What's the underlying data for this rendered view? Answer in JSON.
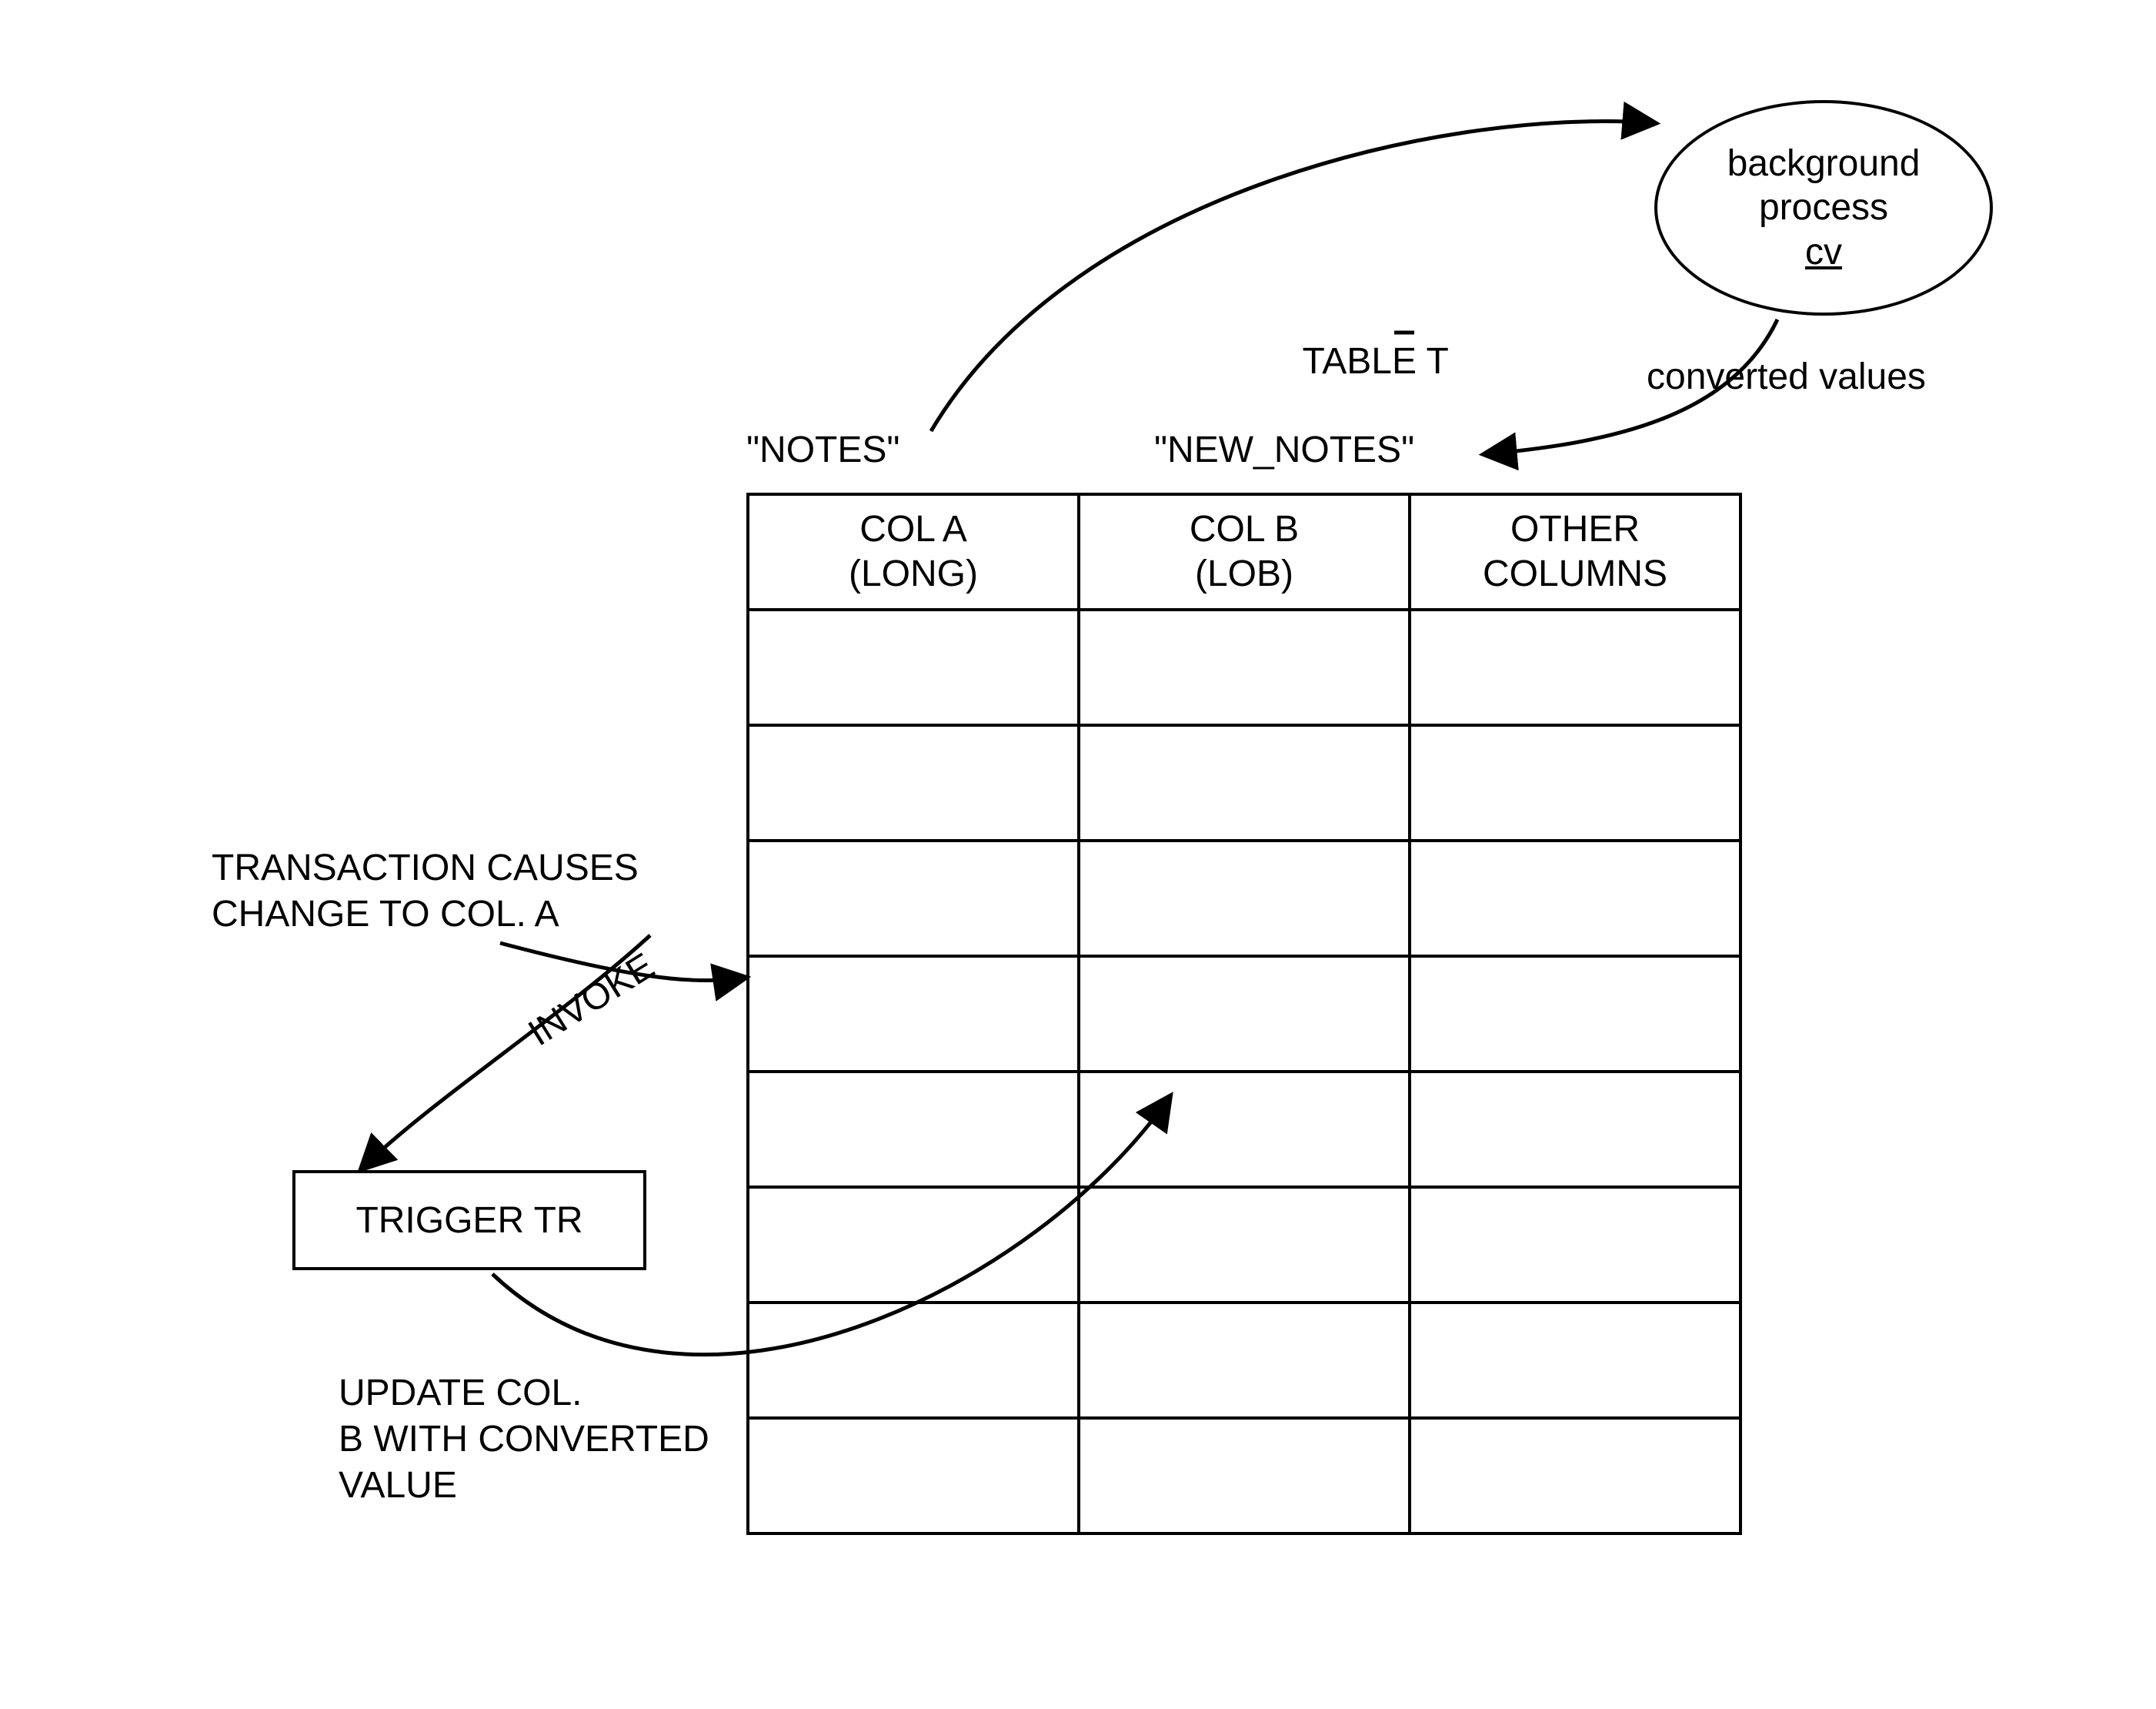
{
  "table_title": "TABLE T",
  "notes_label": "\"NOTES\"",
  "new_notes_label": "\"NEW_NOTES\"",
  "columns": {
    "a": {
      "name": "COL A",
      "type": "(LONG)"
    },
    "b": {
      "name": "COL B",
      "type": "(LOB)"
    },
    "c": {
      "name": "OTHER",
      "type": "COLUMNS"
    }
  },
  "bg_process": {
    "line1": "background",
    "line2": "process",
    "cv": "cv"
  },
  "converted_values_label": "converted values",
  "transaction_text": "TRANSACTION CAUSES\nCHANGE TO COL. A",
  "invoke_label": "INVOKE",
  "trigger_label": "TRIGGER TR",
  "update_text": "UPDATE COL.\nB WITH CONVERTED\nVALUE",
  "underline_char": "T"
}
